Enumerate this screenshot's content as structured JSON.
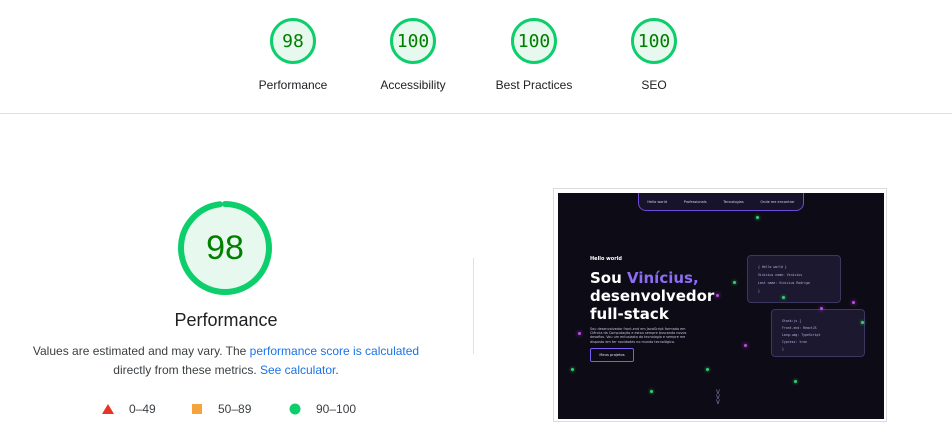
{
  "summary_gauges": [
    {
      "score": "98",
      "label": "Performance"
    },
    {
      "score": "100",
      "label": "Accessibility"
    },
    {
      "score": "100",
      "label": "Best Practices"
    },
    {
      "score": "100",
      "label": "SEO"
    }
  ],
  "main": {
    "score": "98",
    "score_fraction": 0.98,
    "title": "Performance",
    "desc_part1": "Values are estimated and may vary. The ",
    "desc_link1": "performance score is calculated",
    "desc_part2": "directly from these metrics. ",
    "desc_link2": "See calculator",
    "desc_end": "."
  },
  "legend": [
    {
      "range": "0–49",
      "icon": "triangle-icon",
      "color": "#eb3324"
    },
    {
      "range": "50–89",
      "icon": "square-icon",
      "color": "#f4a43a"
    },
    {
      "range": "90–100",
      "icon": "circle-icon",
      "color": "#0cce6b"
    }
  ],
  "colors": {
    "pass": "#0cce6b",
    "pass_text": "#008000",
    "link": "#1a73e8"
  },
  "screenshot": {
    "nav": [
      "Hello world",
      "Professionals",
      "Tecnologias",
      "Onde me encontrar"
    ],
    "hello": "Hello world",
    "hero_line1": "Sou ",
    "hero_name": "Vinícius,",
    "hero_line2": "desenvolvedor",
    "hero_line3": "full-stack",
    "paragraph": "Sou desenvolvedor front-end em JavaScript formado em Ciência da Computação e estou sempre buscando novos desafios. Vou um entusiasta da tecnologia e sempre me disposto em ter novidades no mundo tecnológico.",
    "cta": "Meus projetos",
    "card1_lines": [
      "{ Hello world }",
      "Vinícius name: Vinícius",
      "Last name: Vinícius Rodrigo",
      "}"
    ],
    "card2_lines": [
      "Stack:js {",
      "Front-end: ReactJS",
      "Lang-uag: TypeScript",
      "Cypress: true",
      "}"
    ]
  }
}
